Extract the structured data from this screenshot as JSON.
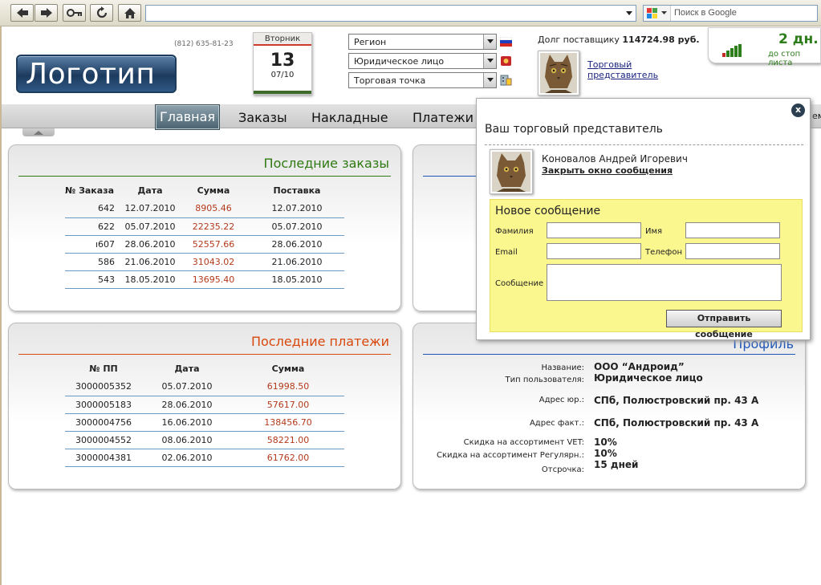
{
  "browser": {
    "search_placeholder": "Поиск в Google",
    "url": ""
  },
  "header": {
    "logo": "Логотип",
    "phone": "(812) 635-81-23",
    "calendar": {
      "weekday": "Вторник",
      "day": "13",
      "month_year": "07/10"
    },
    "selects": [
      "Регион",
      "Юридическое лицо",
      "Торговая точка"
    ],
    "debt_label": "Долг поставщику",
    "debt_value": "114724.98 руб.",
    "rep_link_line1": "Торговый",
    "rep_link_line2": "представитель",
    "days_value": "2 дн.",
    "days_label": "до стоп листа",
    "signal_level": 0.8
  },
  "nav": {
    "items": [
      "Главная",
      "Заказы",
      "Накладные",
      "Платежи"
    ],
    "active": "Главная",
    "cut_item": "ем"
  },
  "orders": {
    "title": "Последние заказы",
    "columns": [
      "№ Заказа",
      "Дата",
      "Сумма",
      "Поставка"
    ],
    "rows": [
      [
        "642",
        "12.07.2010",
        "8905.46",
        "12.07.2010"
      ],
      [
        "622",
        "05.07.2010",
        "22235.22",
        "05.07.2010"
      ],
      [
        "ı607",
        "28.06.2010",
        "52557.66",
        "28.06.2010"
      ],
      [
        "586",
        "21.06.2010",
        "31043.02",
        "21.06.2010"
      ],
      [
        "543",
        "18.05.2010",
        "13695.40",
        "18.05.2010"
      ]
    ]
  },
  "payments": {
    "title": "Последние платежи",
    "columns": [
      "№ ПП",
      "Дата",
      "Сумма"
    ],
    "rows": [
      [
        "3000005352",
        "05.07.2010",
        "61998.50"
      ],
      [
        "3000005183",
        "28.06.2010",
        "57617.00"
      ],
      [
        "3000004756",
        "16.06.2010",
        "138456.70"
      ],
      [
        "3000004552",
        "08.06.2010",
        "58221.00"
      ],
      [
        "3000004381",
        "02.06.2010",
        "61762.00"
      ]
    ]
  },
  "profile": {
    "title": "Профиль",
    "name_label": "Название:",
    "name_value": "ООО “Андроид”",
    "type_label": "Тип пользователя:",
    "type_value": "Юридическое лицо",
    "addr_legal_label": "Адрес юр.:",
    "addr_legal_value": "СПб, Полюстровский пр. 43 А",
    "addr_fact_label": "Адрес факт.:",
    "addr_fact_value": "СПб, Полюстровский пр. 43 А",
    "disc_vet_label": "Скидка на ассортимент VET:",
    "disc_vet_value": "10%",
    "disc_reg_label": "Скидка на ассортимент Регулярн.:",
    "disc_reg_value": "10%",
    "delay_label": "Отсрочка:",
    "delay_value": "15 дней"
  },
  "popup": {
    "close": "x",
    "title": "Ваш торговый представитель",
    "rep_name": "Коновалов Андрей Игоревич",
    "close_link": "Закрыть окно сообщения",
    "form": {
      "heading": "Новое сообщение",
      "surname_label": "Фамилия",
      "name_label": "Имя",
      "email_label": "Email",
      "phone_label": "Телефон",
      "message_label": "Сообщение",
      "send_button": "Отправить сообщение"
    }
  },
  "colors": {
    "orders_title": "#2f7a12",
    "payments_title": "#d9470b",
    "profile_title": "#1c56b8",
    "amount": "#b33a1c"
  }
}
